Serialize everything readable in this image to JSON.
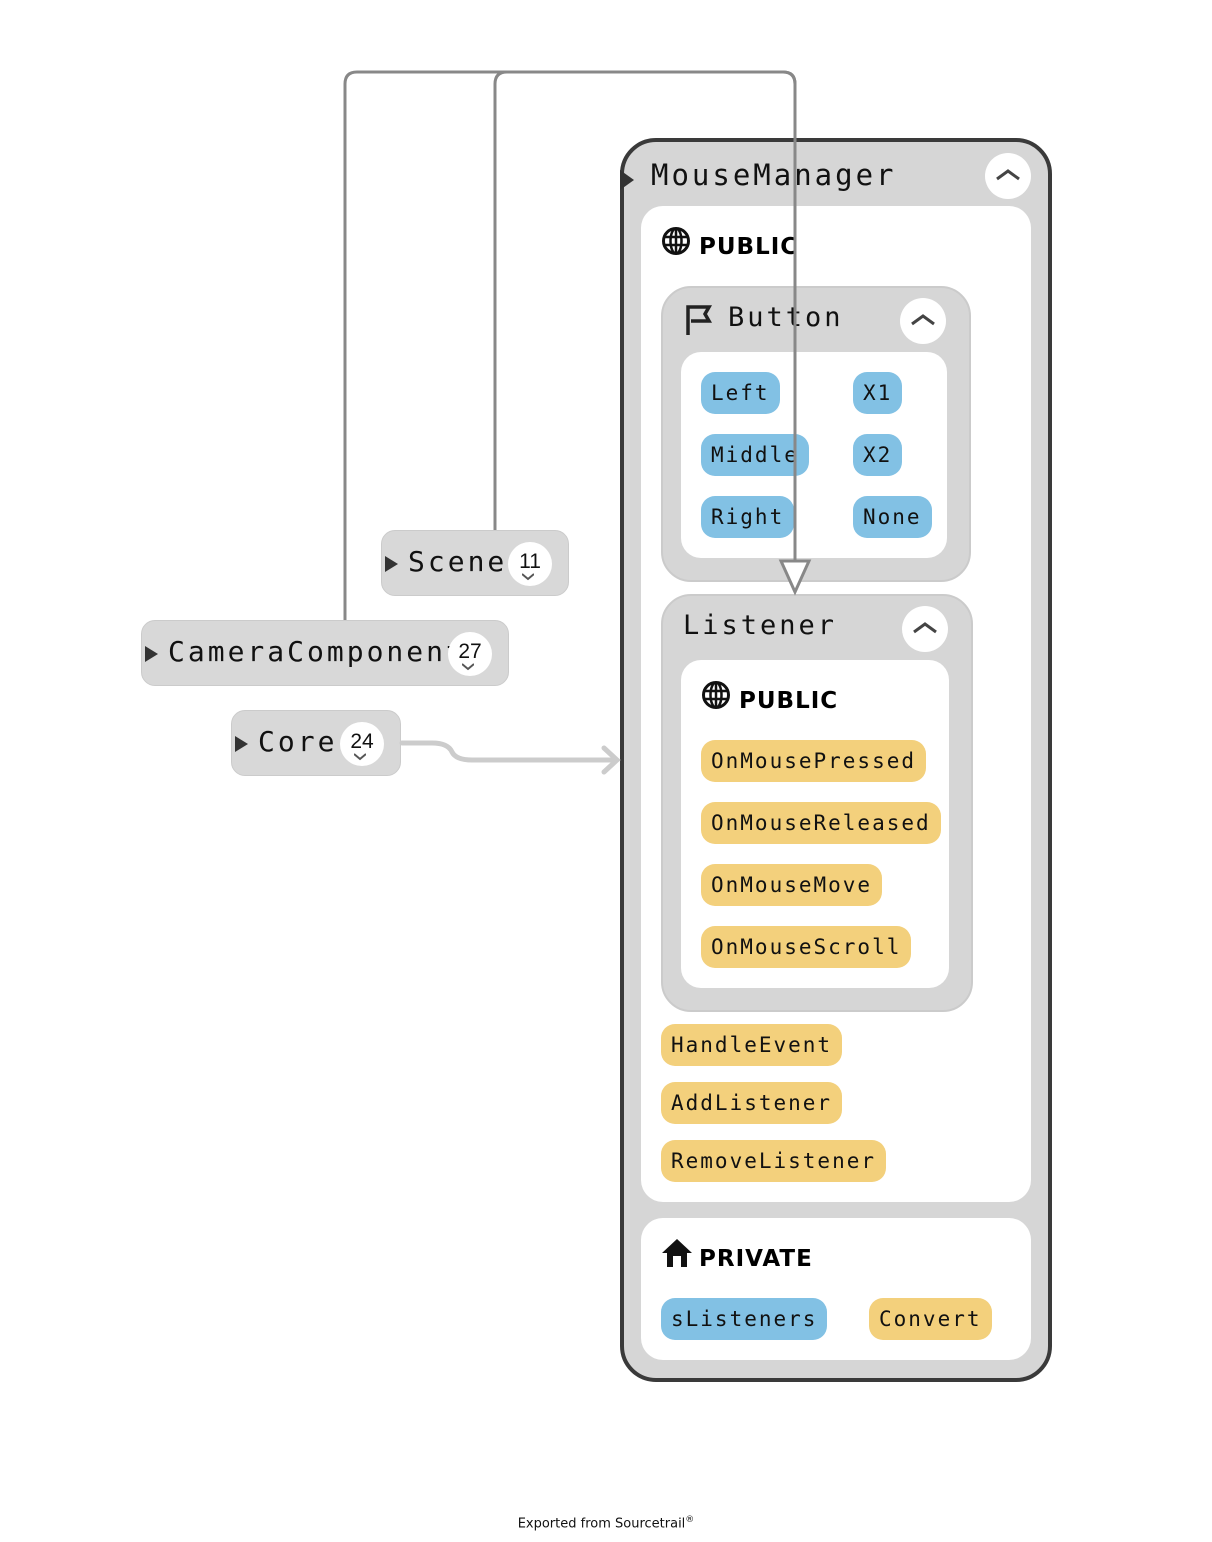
{
  "colors": {
    "field": "#82c1e4",
    "function": "#f3d07c",
    "node_bg": "#d6d6d6",
    "edge_inheritance": "#888888",
    "edge_usage": "#cccccc",
    "focus_border": "#3a3a3a"
  },
  "nodes": {
    "scene": {
      "name": "Scene",
      "count": "11",
      "icon": "expand-triangle-icon"
    },
    "camera_component": {
      "name": "CameraComponent",
      "count": "27",
      "icon": "expand-triangle-icon"
    },
    "core": {
      "name": "Core",
      "count": "24",
      "icon": "expand-triangle-icon"
    }
  },
  "mouse_manager": {
    "name": "MouseManager",
    "collapse_icon": "chevron-up-icon",
    "public": {
      "label": "PUBLIC",
      "icon": "globe-icon",
      "button_enum": {
        "name": "Button",
        "icon": "flag-icon",
        "values": [
          "Left",
          "Middle",
          "Right",
          "X1",
          "X2",
          "None"
        ]
      },
      "listener": {
        "name": "Listener",
        "public_label": "PUBLIC",
        "methods": [
          "OnMousePressed",
          "OnMouseReleased",
          "OnMouseMove",
          "OnMouseScroll"
        ]
      },
      "methods": [
        "HandleEvent",
        "AddListener",
        "RemoveListener"
      ]
    },
    "private": {
      "label": "PRIVATE",
      "icon": "house-icon",
      "fields": [
        "sListeners"
      ],
      "methods": [
        "Convert"
      ]
    }
  },
  "footer": {
    "text": "Exported from Sourcetrail",
    "mark": "®"
  }
}
